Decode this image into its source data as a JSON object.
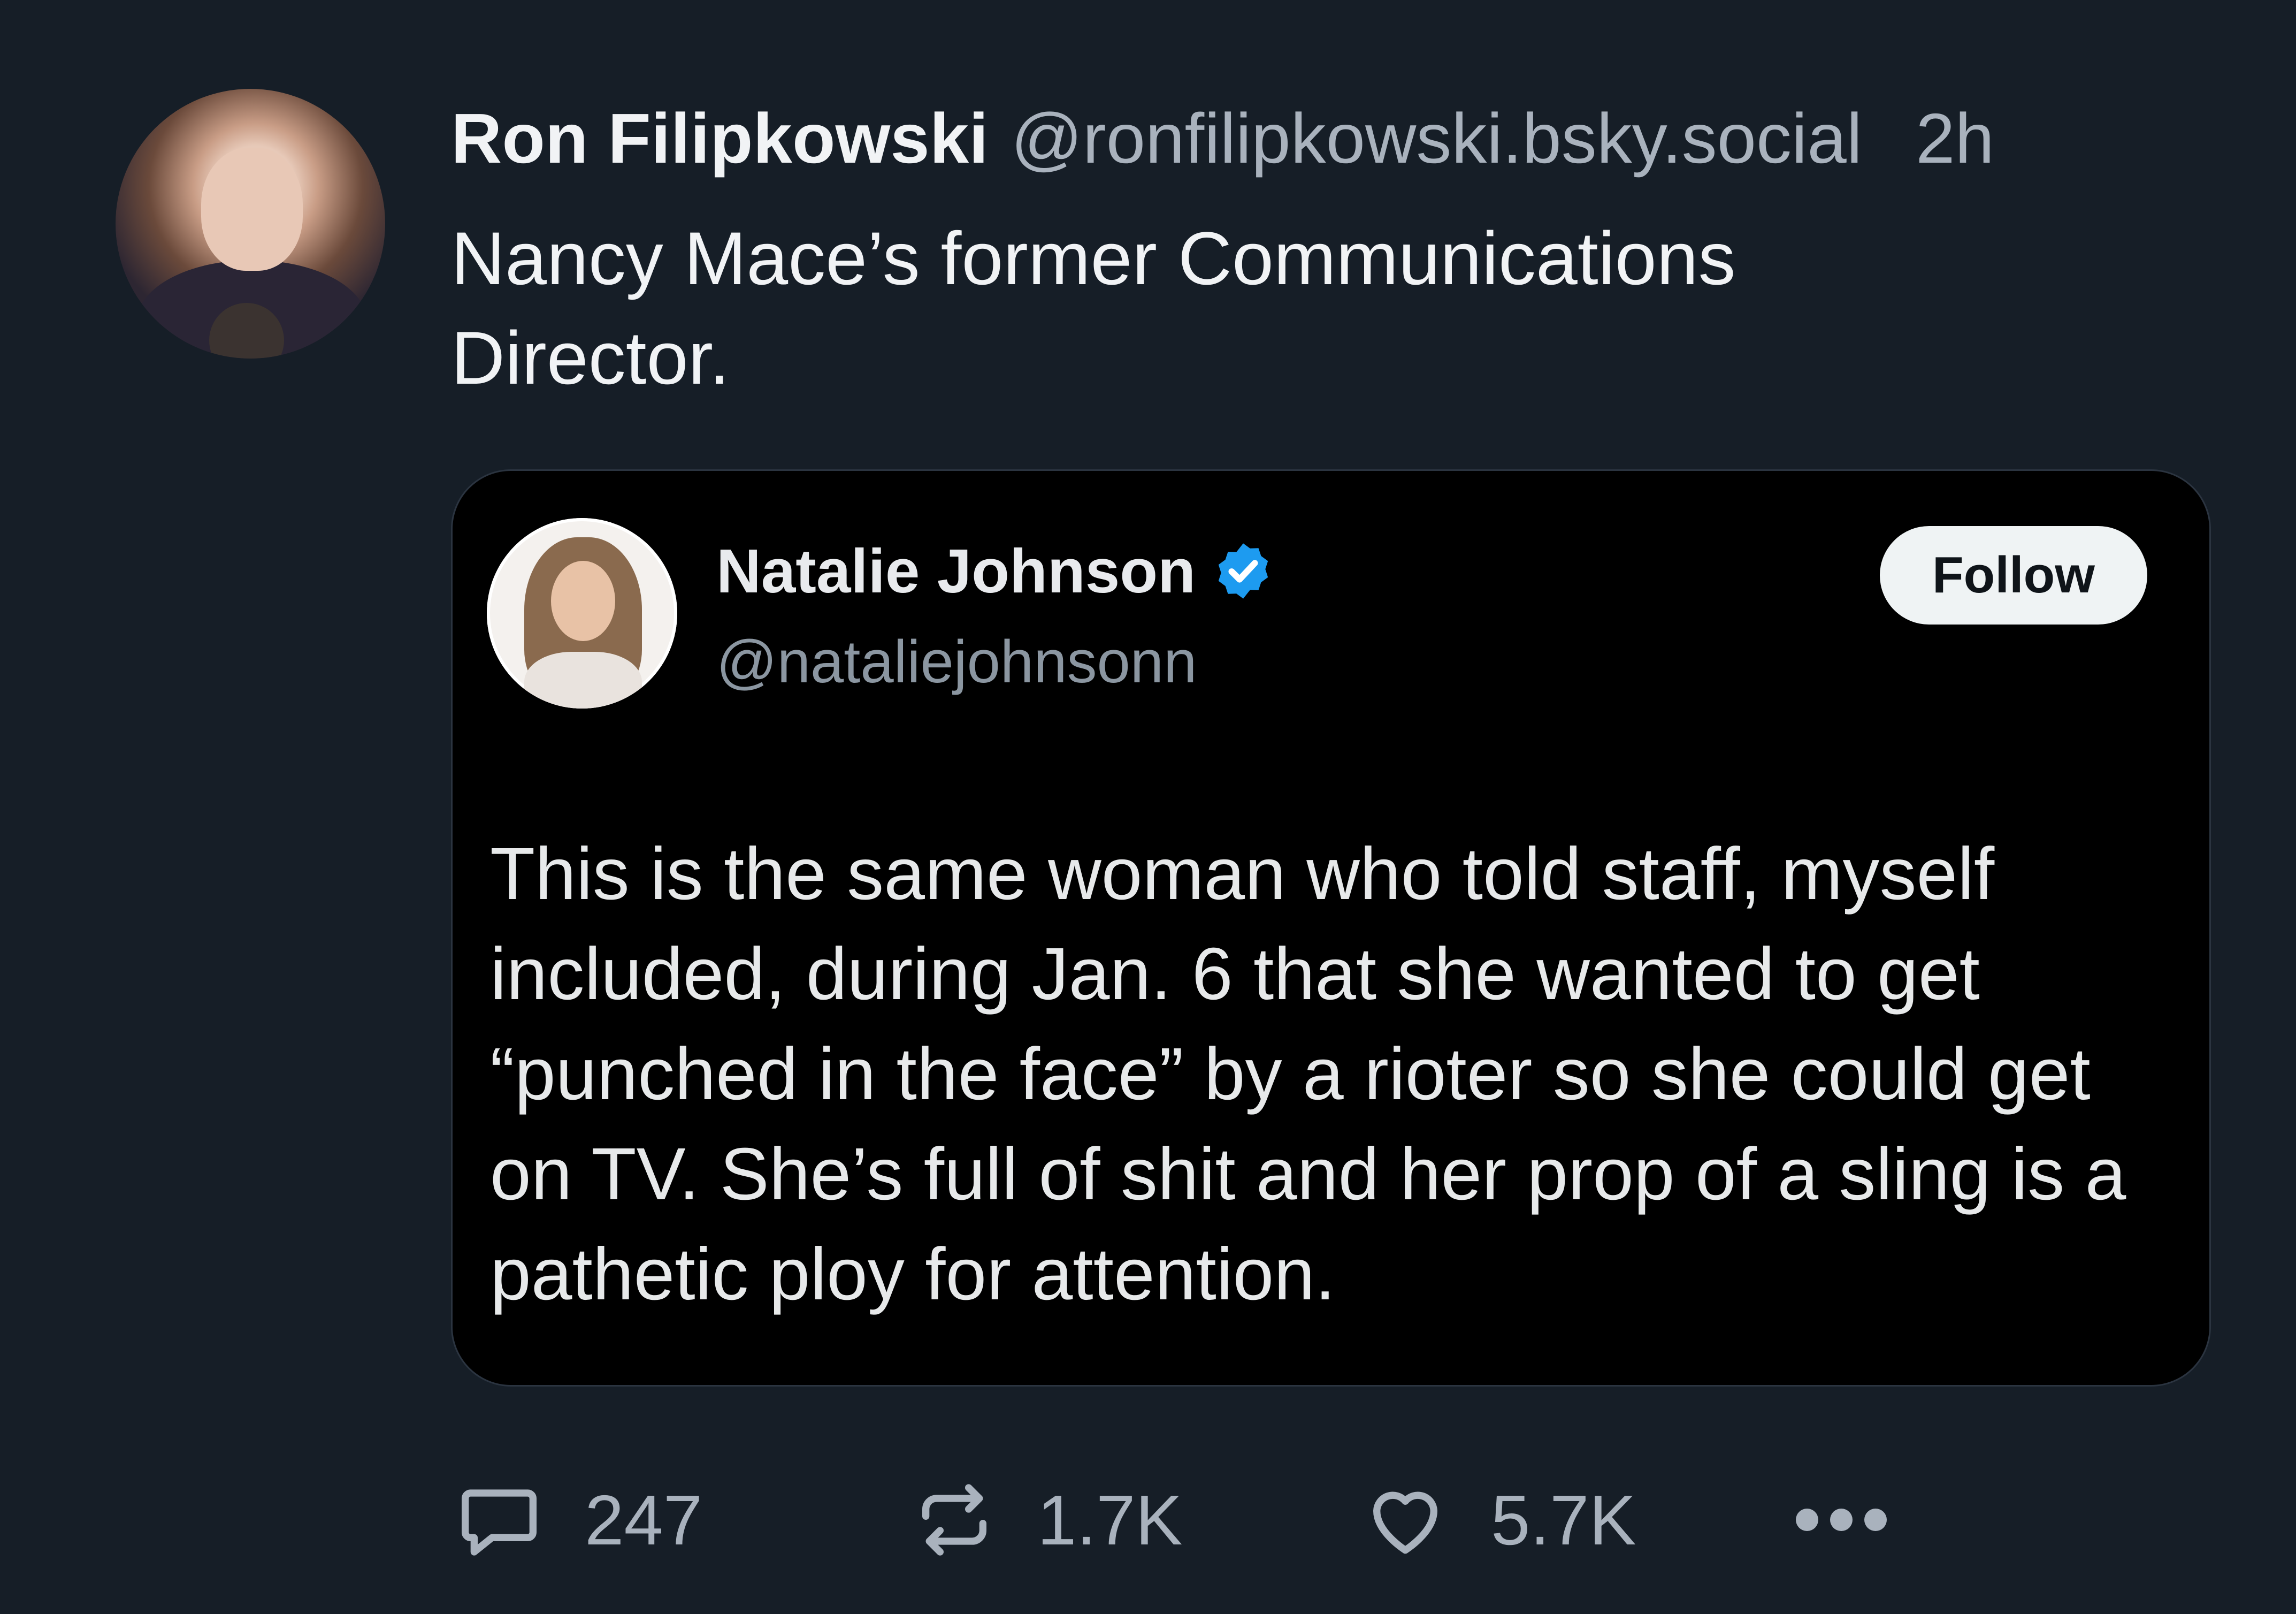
{
  "post": {
    "author_name": "Ron Filipkowski",
    "author_handle": "@ronfilipkowski.bsky.social",
    "time": "2h",
    "text_lines": [
      "Nancy Mace’s former Communications",
      "Director."
    ]
  },
  "quote": {
    "author_name": "Natalie Johnson",
    "author_handle": "@nataliejohnsonn",
    "follow_label": "Follow",
    "text_lines": [
      "This is the same woman who told staff, myself",
      "included, during Jan. 6 that she wanted to get",
      "“punched in the face” by a rioter so she could get",
      "on TV. She’s full of shit and her prop of a sling is a",
      "pathetic ploy for attention."
    ]
  },
  "actions": {
    "replies": "247",
    "reposts": "1.7K",
    "likes": "5.7K"
  },
  "icons": {
    "reply": "reply-icon",
    "repost": "repost-icon",
    "like": "heart-icon",
    "more": "more-options-icon",
    "verified": "verified-badge-icon"
  },
  "colors": {
    "background": "#161e27",
    "quote_background": "#000000",
    "verified": "#1d9bf0",
    "muted_text": "#a9b2bd"
  }
}
